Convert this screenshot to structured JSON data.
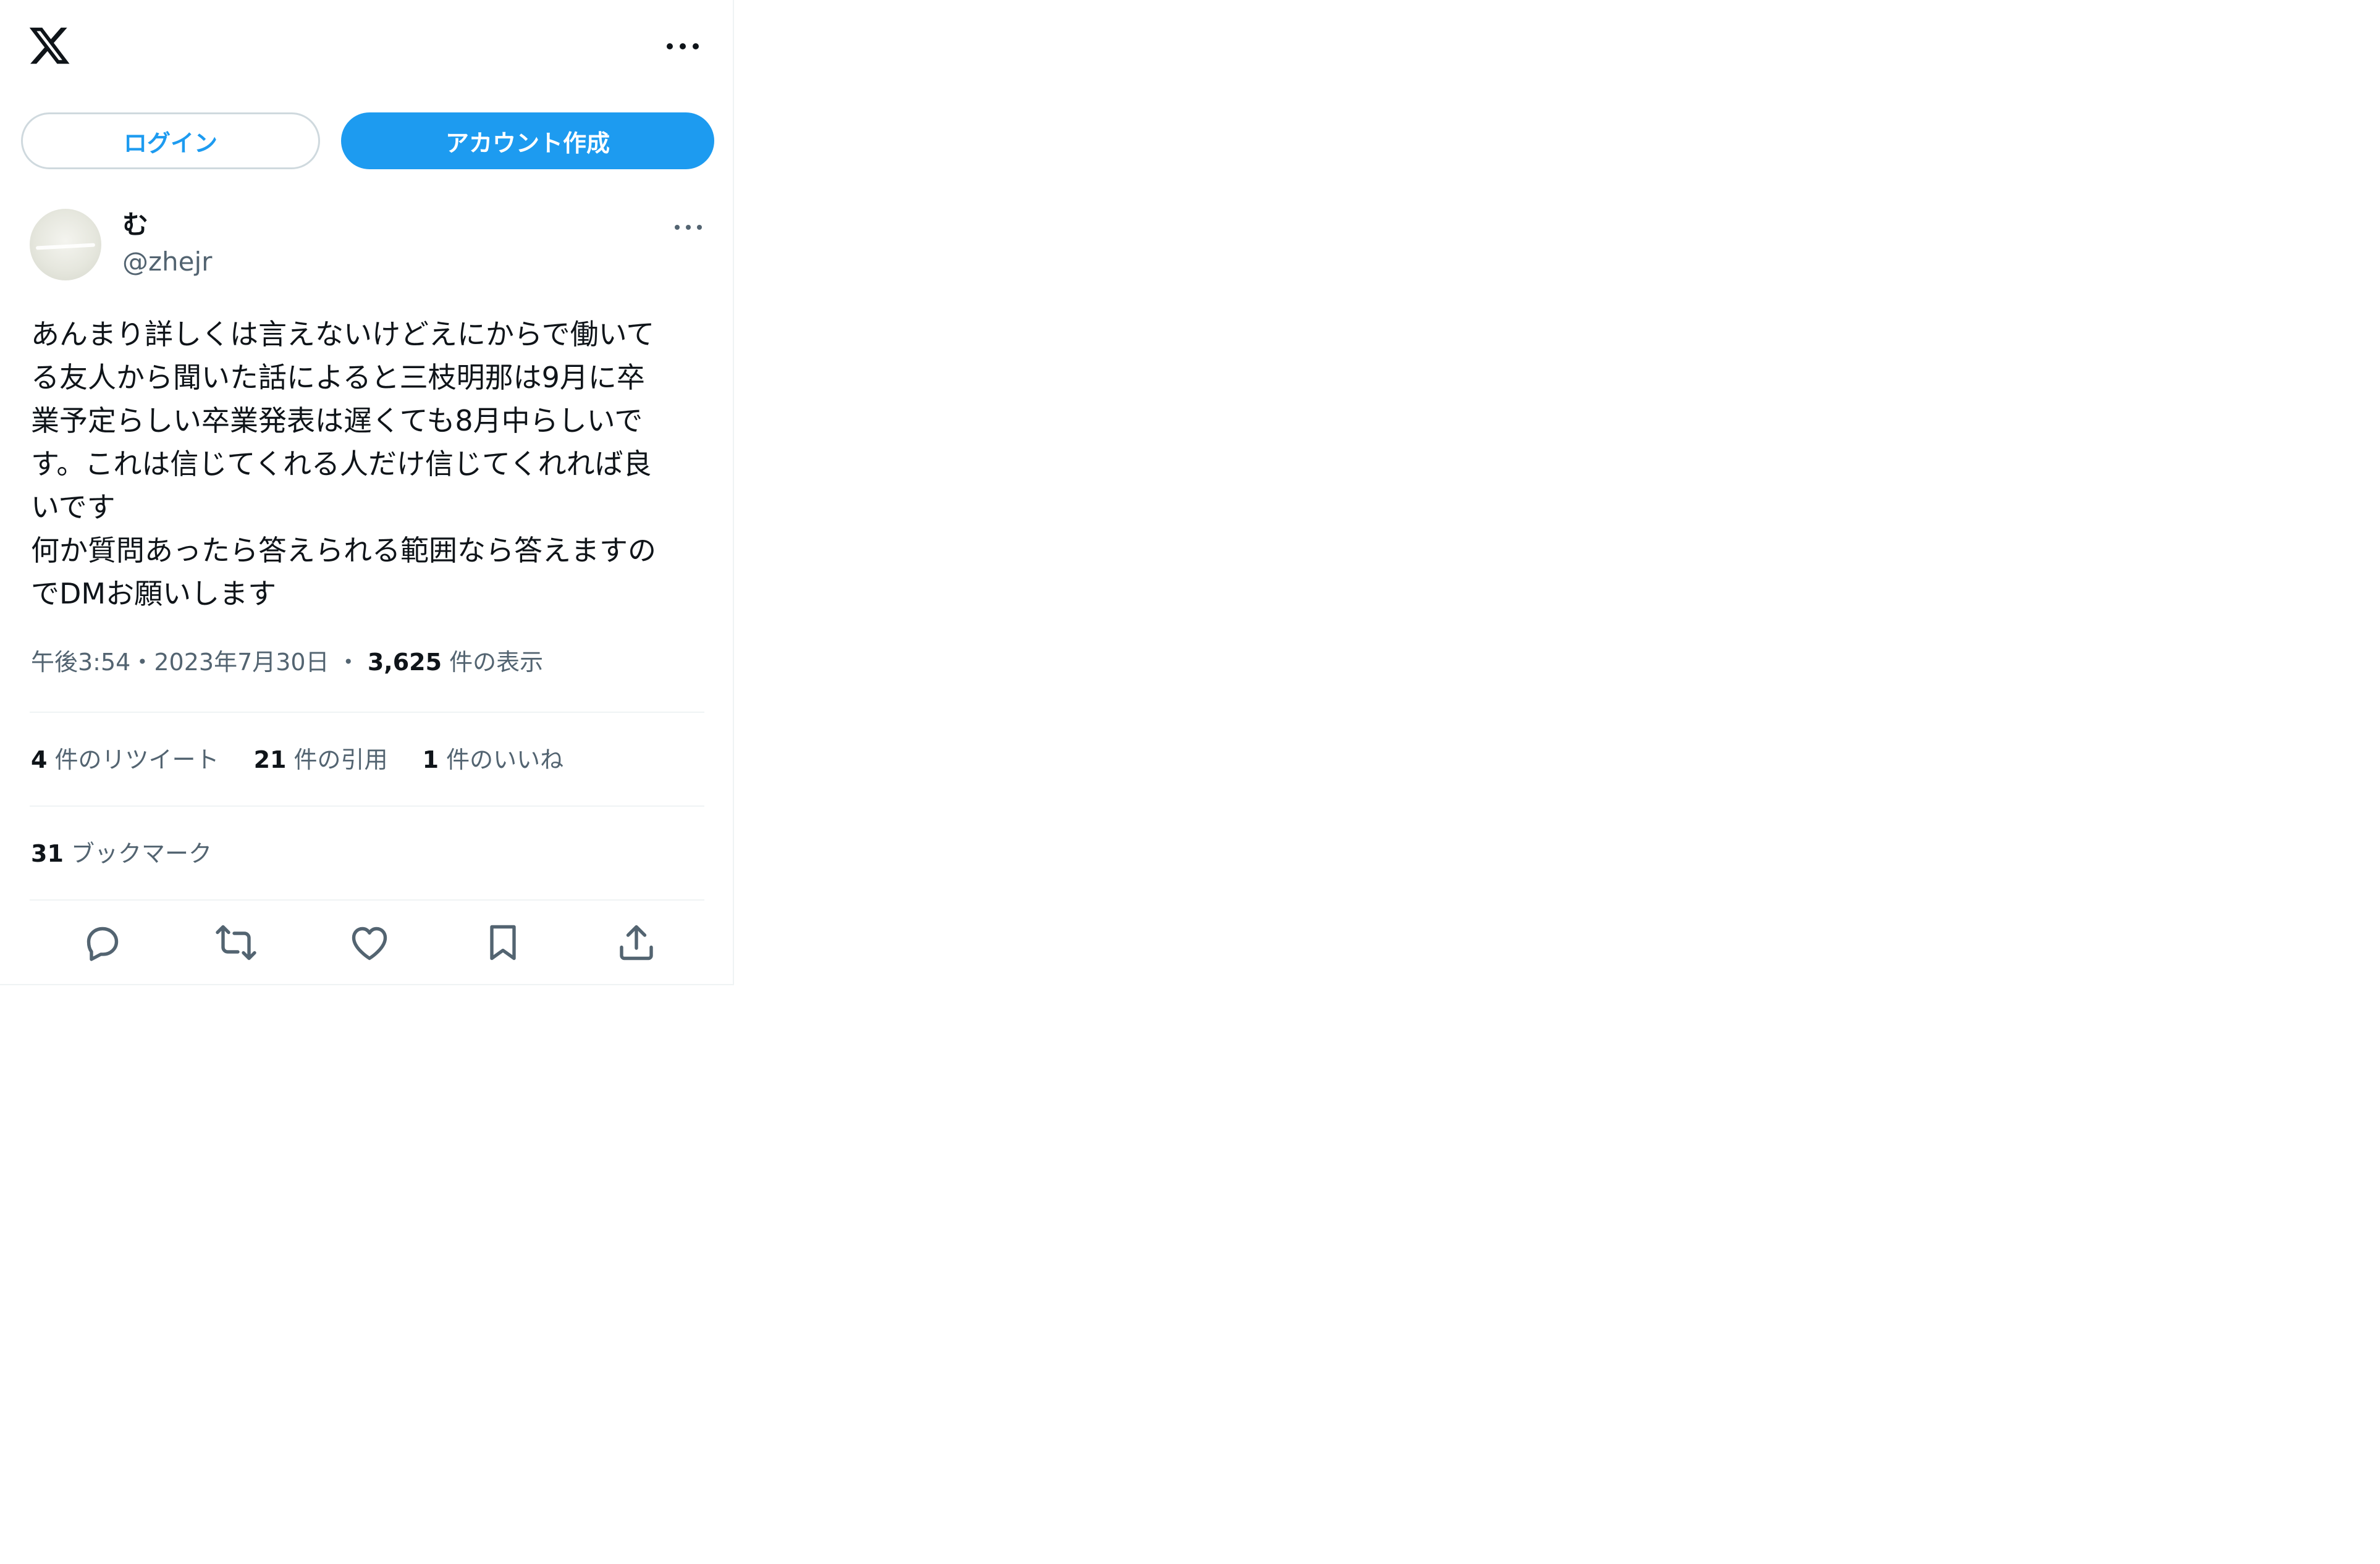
{
  "header": {
    "logo_icon": "x-logo-icon",
    "more_icon": "more-horizontal-icon"
  },
  "auth": {
    "login_label": "ログイン",
    "signup_label": "アカウント作成"
  },
  "tweet": {
    "author": {
      "display_name": "む",
      "handle": "@zhejr"
    },
    "text": "あんまり詳しくは言えないけどえにからで働いて\nる友人から聞いた話によると三枝明那は9月に卒\n業予定らしい卒業発表は遅くても8月中らしいで\nす。これは信じてくれる人だけ信じてくれれば良\nいです\n何か質問あったら答えられる範囲なら答えますの\nでDMお願いします",
    "time": "午後3:54",
    "separator": "・",
    "date": "2023年7月30日",
    "views_count": "3,625",
    "views_label": "件の表示",
    "stats": {
      "retweets_count": "4",
      "retweets_label": "件のリツイート",
      "quotes_count": "21",
      "quotes_label": "件の引用",
      "likes_count": "1",
      "likes_label": "件のいいね",
      "bookmarks_count": "31",
      "bookmarks_label": "ブックマーク"
    },
    "actions": [
      "reply-icon",
      "retweet-icon",
      "like-icon",
      "bookmark-icon",
      "share-icon"
    ]
  },
  "colors": {
    "accent": "#1d9bf0",
    "text": "#0f1419",
    "secondary": "#536471",
    "border": "#cfd9de",
    "divider": "#eff3f4"
  }
}
